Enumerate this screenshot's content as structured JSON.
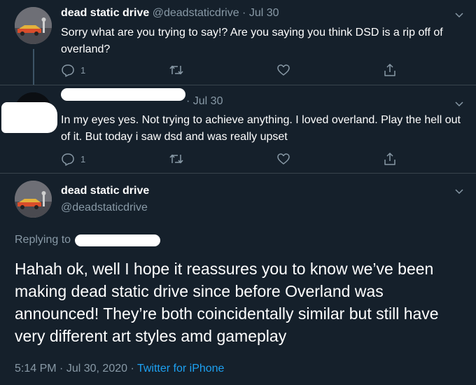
{
  "tweets": [
    {
      "display_name": "dead static drive",
      "handle": "@deadstaticdrive",
      "separator": "·",
      "date": "Jul 30",
      "text": "Sorry what are you trying to say!? Are you saying you think DSD is a rip off of overland?",
      "reply_count": "1",
      "avatar_icon": "car-art-avatar"
    },
    {
      "separator": "·",
      "date": "Jul 30",
      "text": "In my eyes yes. Not trying to achieve anything. I loved overland. Play the hell out of it. But today i saw dsd and was really upset",
      "reply_count": "1",
      "avatar_icon": "redacted-avatar"
    }
  ],
  "focused": {
    "display_name": "dead static drive",
    "handle": "@deadstaticdrive",
    "replying_to_label": "Replying to",
    "text": "Hahah ok, well I hope it reassures you to know we’ve been making dead static drive since before Overland was announced! They’re both coincidentally similar but still have very different art styles amd gameplay",
    "time": "5:14 PM",
    "meta_sep": "·",
    "date": "Jul 30, 2020",
    "source_sep": "·",
    "source": "Twitter for iPhone"
  },
  "colors": {
    "background": "#15202b",
    "muted_text": "#8899a6",
    "link": "#1da1f2",
    "divider": "#38444d"
  }
}
